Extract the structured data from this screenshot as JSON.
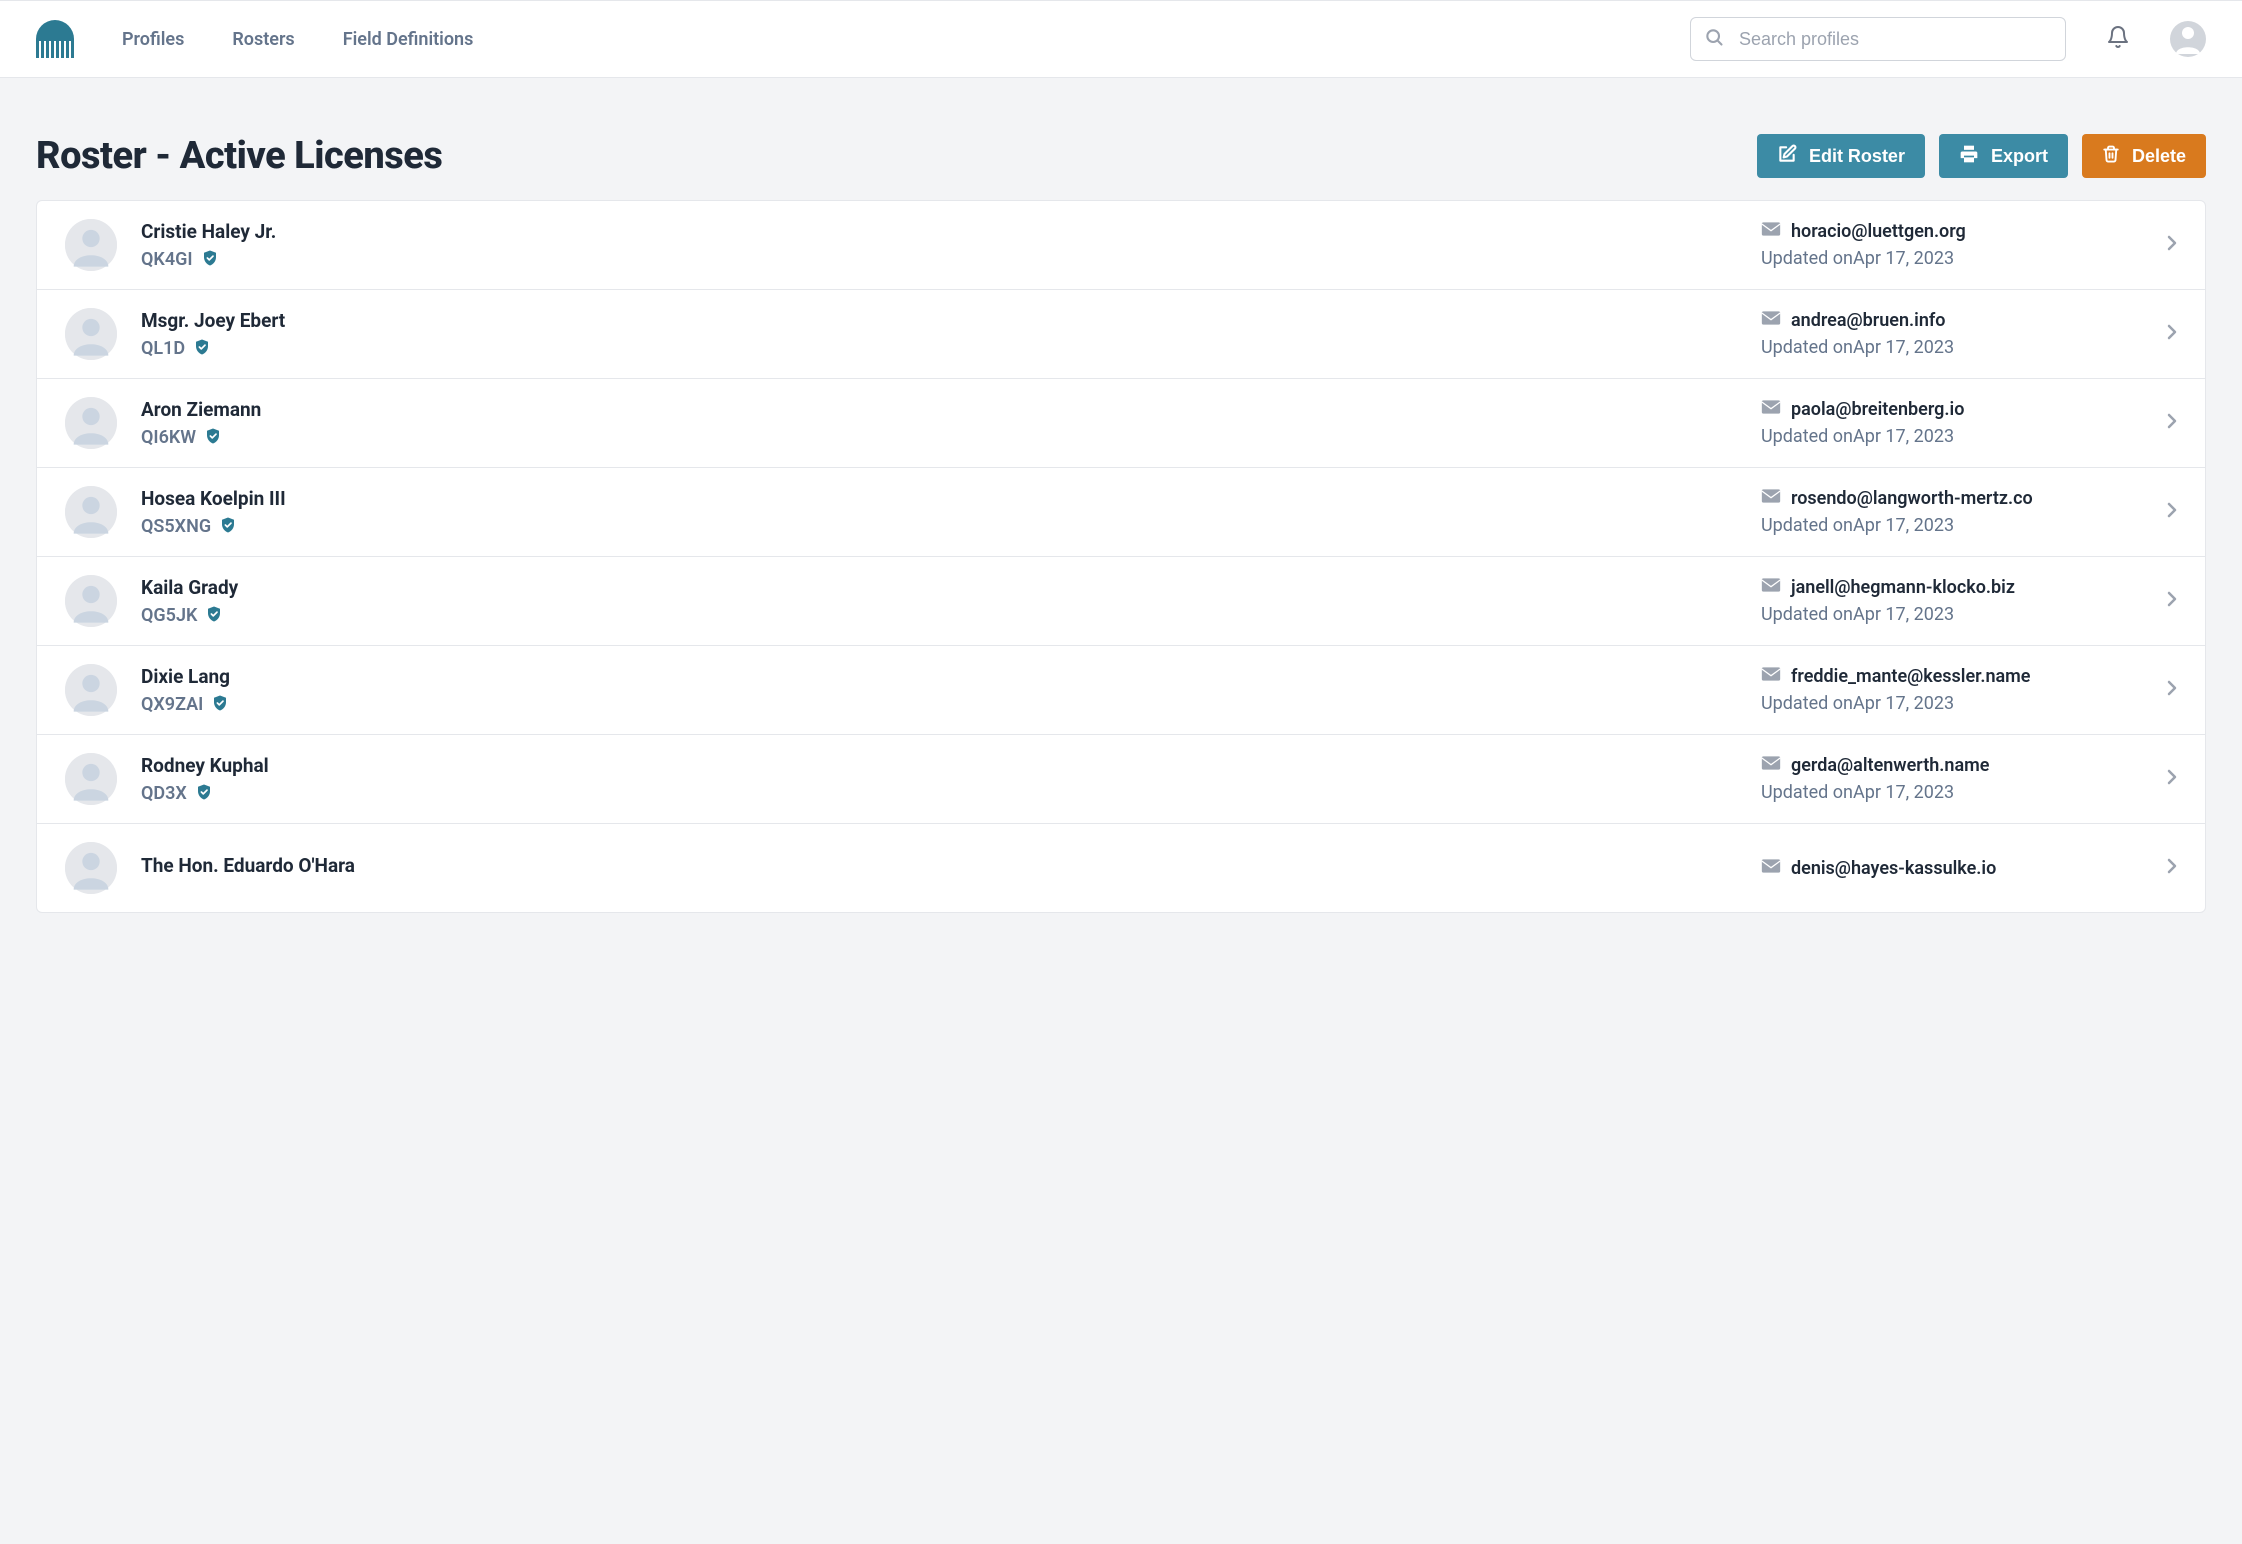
{
  "nav": {
    "profiles": "Profiles",
    "rosters": "Rosters",
    "field_definitions": "Field Definitions"
  },
  "search": {
    "placeholder": "Search profiles"
  },
  "page": {
    "title": "Roster - Active Licenses"
  },
  "actions": {
    "edit": "Edit Roster",
    "export": "Export",
    "delete": "Delete"
  },
  "updated_prefix": "Updated on",
  "rows": [
    {
      "name": "Cristie Haley Jr.",
      "code": "QK4GI",
      "email": "horacio@luettgen.org",
      "updated": "Apr 17, 2023"
    },
    {
      "name": "Msgr. Joey Ebert",
      "code": "QL1D",
      "email": "andrea@bruen.info",
      "updated": "Apr 17, 2023"
    },
    {
      "name": "Aron Ziemann",
      "code": "QI6KW",
      "email": "paola@breitenberg.io",
      "updated": "Apr 17, 2023"
    },
    {
      "name": "Hosea Koelpin III",
      "code": "QS5XNG",
      "email": "rosendo@langworth-mertz.co",
      "updated": "Apr 17, 2023"
    },
    {
      "name": "Kaila Grady",
      "code": "QG5JK",
      "email": "janell@hegmann-klocko.biz",
      "updated": "Apr 17, 2023"
    },
    {
      "name": "Dixie Lang",
      "code": "QX9ZAI",
      "email": "freddie_mante@kessler.name",
      "updated": "Apr 17, 2023"
    },
    {
      "name": "Rodney Kuphal",
      "code": "QD3X",
      "email": "gerda@altenwerth.name",
      "updated": "Apr 17, 2023"
    },
    {
      "name": "The Hon. Eduardo O'Hara",
      "code": "",
      "email": "denis@hayes-kassulke.io",
      "updated": ""
    }
  ]
}
